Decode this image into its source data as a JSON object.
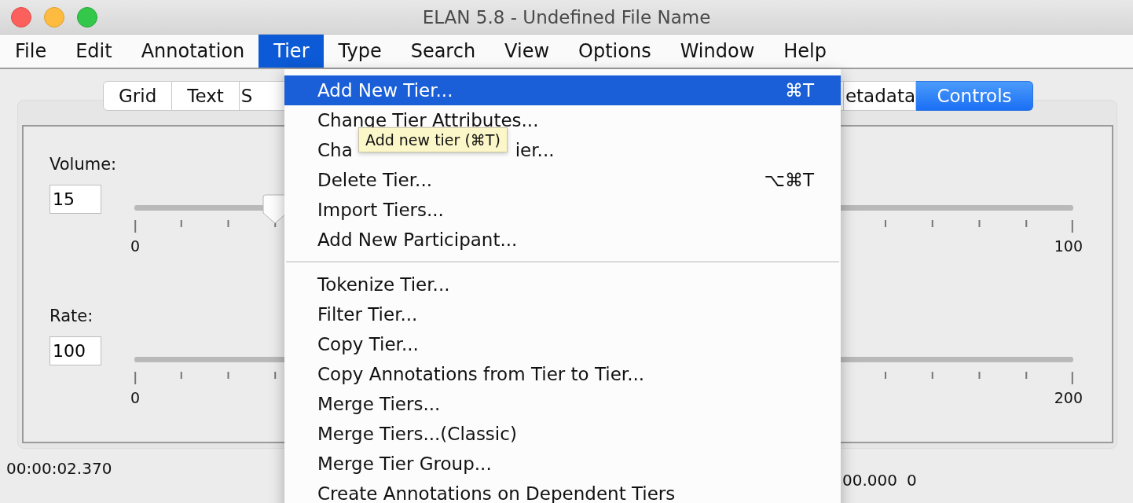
{
  "window": {
    "title": "ELAN 5.8 - Undefined File Name"
  },
  "menu_bar": [
    {
      "label": "File",
      "selected": false
    },
    {
      "label": "Edit",
      "selected": false
    },
    {
      "label": "Annotation",
      "selected": false
    },
    {
      "label": "Tier",
      "selected": true
    },
    {
      "label": "Type",
      "selected": false
    },
    {
      "label": "Search",
      "selected": false
    },
    {
      "label": "View",
      "selected": false
    },
    {
      "label": "Options",
      "selected": false
    },
    {
      "label": "Window",
      "selected": false
    },
    {
      "label": "Help",
      "selected": false
    }
  ],
  "tabs": [
    {
      "label": "Grid",
      "selected": false
    },
    {
      "label": "Text",
      "selected": false
    },
    {
      "label": "S",
      "selected": false
    },
    {
      "label": "etadata",
      "selected": false
    },
    {
      "label": "Controls",
      "selected": true
    }
  ],
  "controls": [
    {
      "label": "Volume:",
      "value": "15",
      "level": 0.15,
      "tick_labels": [
        "0",
        "100"
      ]
    },
    {
      "label": "Rate:",
      "value": "100",
      "tick_labels": [
        "0",
        "200"
      ]
    }
  ],
  "status": {
    "time": "00:00:02.370",
    "selection": "00.000",
    "count": "0"
  },
  "tier_menu": {
    "items": [
      {
        "kind": "item",
        "label": "Add New Tier...",
        "shortcut": "⌘T",
        "selected": true
      },
      {
        "kind": "item",
        "label": "Change Tier Attributes...",
        "selected": false
      },
      {
        "kind": "covered",
        "label_start": "Cha",
        "label_end": "ier...",
        "selected": false
      },
      {
        "kind": "item",
        "label": "Delete Tier...",
        "shortcut": "⌥⌘T",
        "selected": false
      },
      {
        "kind": "item",
        "label": "Import Tiers...",
        "selected": false
      },
      {
        "kind": "item",
        "label": "Add New Participant...",
        "selected": false
      },
      {
        "kind": "separator"
      },
      {
        "kind": "item",
        "label": "Tokenize Tier...",
        "selected": false
      },
      {
        "kind": "item",
        "label": "Filter Tier...",
        "selected": false
      },
      {
        "kind": "item",
        "label": "Copy Tier...",
        "selected": false
      },
      {
        "kind": "item",
        "label": "Copy Annotations from Tier to Tier...",
        "selected": false
      },
      {
        "kind": "item",
        "label": "Merge Tiers...",
        "selected": false
      },
      {
        "kind": "item",
        "label": "Merge Tiers...(Classic)",
        "selected": false
      },
      {
        "kind": "item",
        "label": "Merge Tier Group...",
        "selected": false
      },
      {
        "kind": "item",
        "label": "Create Annotations on Dependent Tiers",
        "selected": false
      }
    ]
  },
  "tooltip": {
    "text": "Add new tier (⌘T)"
  }
}
